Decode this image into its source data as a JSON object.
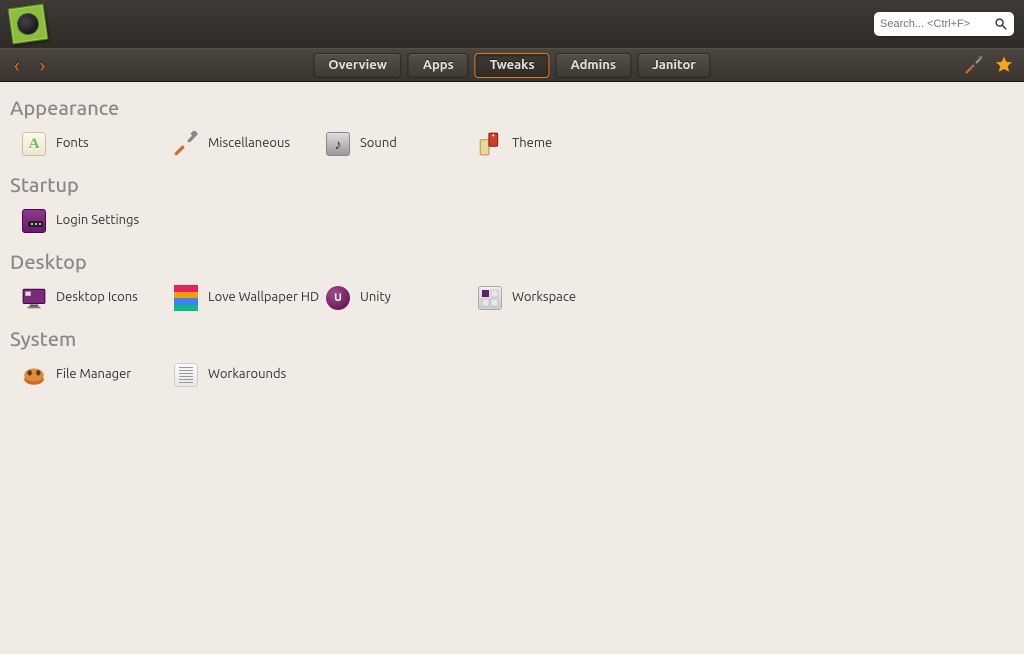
{
  "search": {
    "placeholder": "Search... <Ctrl+F>"
  },
  "nav": {
    "tabs": [
      "Overview",
      "Apps",
      "Tweaks",
      "Admins",
      "Janitor"
    ],
    "active": 2
  },
  "sections": [
    {
      "title": "Appearance",
      "items": [
        {
          "label": "Fonts",
          "icon": "fonts"
        },
        {
          "label": "Miscellaneous",
          "icon": "misc"
        },
        {
          "label": "Sound",
          "icon": "sound"
        },
        {
          "label": "Theme",
          "icon": "theme"
        }
      ]
    },
    {
      "title": "Startup",
      "items": [
        {
          "label": "Login Settings",
          "icon": "login"
        }
      ]
    },
    {
      "title": "Desktop",
      "items": [
        {
          "label": "Desktop Icons",
          "icon": "deskicons"
        },
        {
          "label": "Love Wallpaper HD",
          "icon": "wallpaper"
        },
        {
          "label": "Unity",
          "icon": "unity"
        },
        {
          "label": "Workspace",
          "icon": "workspace"
        }
      ]
    },
    {
      "title": "System",
      "items": [
        {
          "label": "File Manager",
          "icon": "filemgr"
        },
        {
          "label": "Workarounds",
          "icon": "workarounds"
        }
      ]
    }
  ]
}
